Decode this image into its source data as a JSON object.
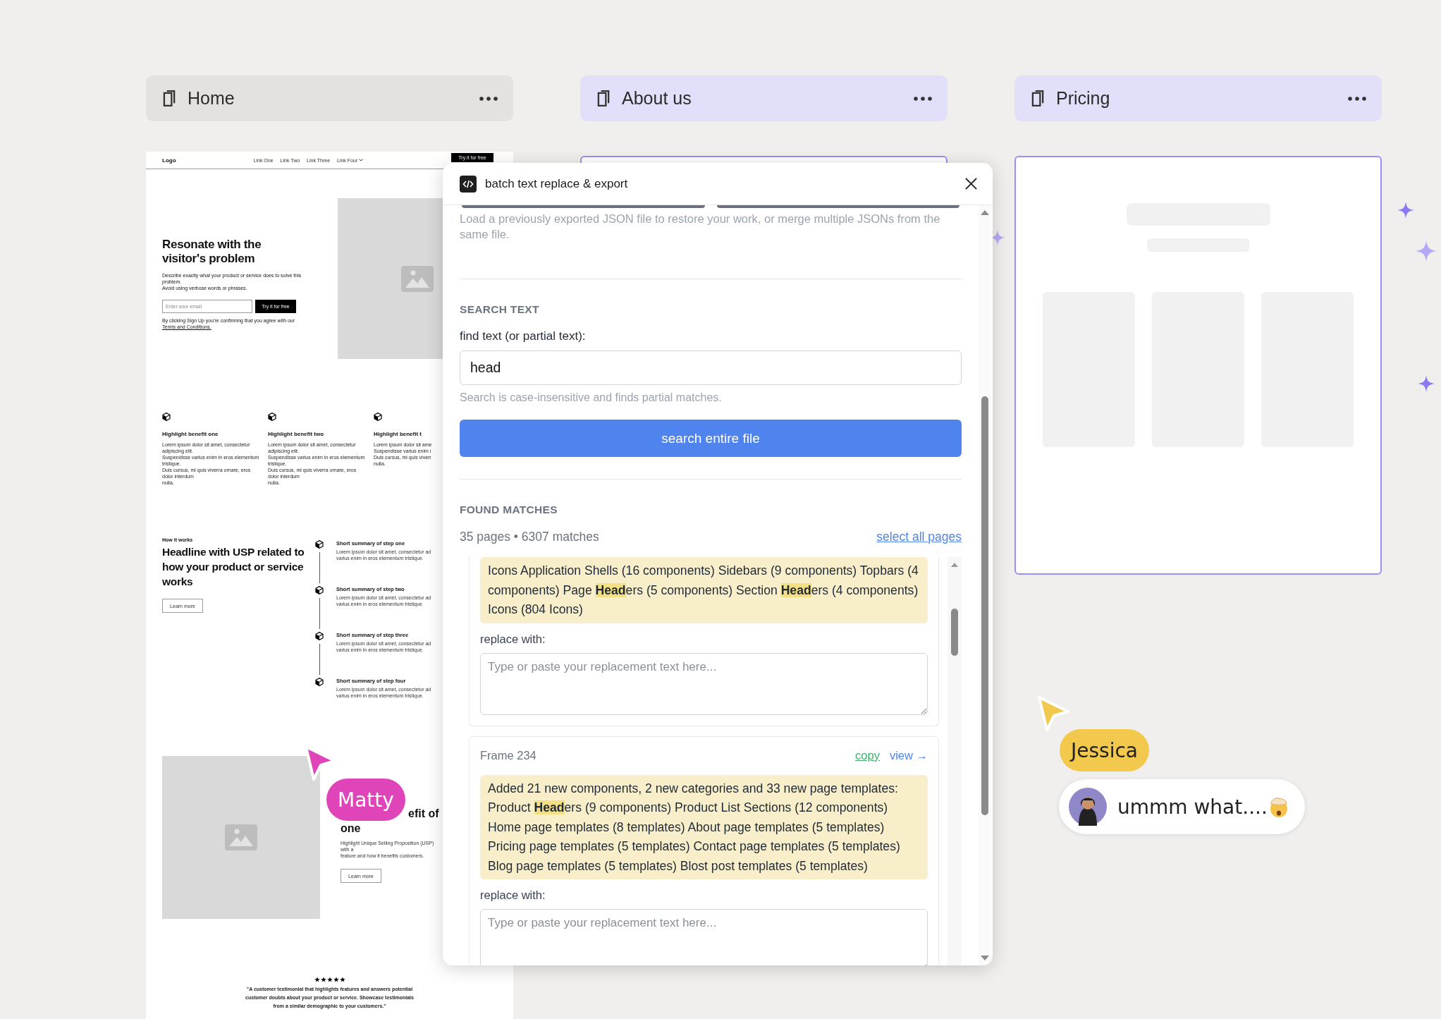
{
  "canvas": {
    "frames": [
      {
        "kind": "wireframe",
        "title": "Home",
        "selected": false,
        "content": {
          "nav": {
            "logo": "Logo",
            "links": [
              {
                "label": "Link One",
                "dropdown": false
              },
              {
                "label": "Link Two",
                "dropdown": false
              },
              {
                "label": "Link Three",
                "dropdown": false
              },
              {
                "label": "Link Four",
                "dropdown": true
              }
            ],
            "cta": "Try it for free"
          },
          "hero": {
            "heading": "Resonate with the visitor's problem",
            "description": [
              "Describe exactly what your product or service does to solve this problem.",
              "Avoid using verbose words or phrases."
            ],
            "email_placeholder": "Enter your email",
            "button": "Try it for free",
            "terms_text": "By clicking Sign Up you're confirming that you agree with our",
            "terms_link": "Terms and Conditions."
          },
          "benefits": [
            {
              "title": "Highlight benefit one",
              "body": [
                "Lorem ipsum dolor sit amet, consectetur adipiscing elit.",
                "Suspendisse varius enim in eros elementum tristique.",
                "Duis cursus, mi quis viverra ornare, eros dolor interdum",
                "nulla."
              ]
            },
            {
              "title": "Highlight benefit two",
              "body": [
                "Lorem ipsum dolor sit amet, consectetur adipiscing elit.",
                "Suspendisse varius enim in eros elementum tristique.",
                "Duis cursus, mi quis viverra ornare, eros dolor interdum",
                "nulla."
              ]
            },
            {
              "title": "Highlight benefit t",
              "body": [
                "Lorem ipsum dolor sit ame",
                "Suspendisse varius enim i",
                "Duis cursus, mi quis viverr",
                "nulla."
              ]
            }
          ],
          "how": {
            "eyebrow": "How it works",
            "heading": [
              "Headline with USP related to",
              "how your product or service",
              "works"
            ],
            "button": "Learn more",
            "steps": [
              {
                "title": "Short summary of step one",
                "body": [
                  "Lorem ipsum dolor sit amet, consectetur ad",
                  "varius enim in eros elementum tristique."
                ]
              },
              {
                "title": "Short summary of step two",
                "body": [
                  "Lorem ipsum dolor sit amet, consectetur ad",
                  "varius enim in eros elementum tristique."
                ]
              },
              {
                "title": "Short summary of step three",
                "body": [
                  "Lorem ipsum dolor sit amet, consectetur ad",
                  "varius enim in eros elementum tristique."
                ]
              },
              {
                "title": "Short summary of step four",
                "body": [
                  "Lorem ipsum dolor sit amet, consectetur ad",
                  "varius enim in eros elementum tristique."
                ]
              }
            ]
          },
          "feature": {
            "heading_fragments": [
              "efit of",
              "one"
            ],
            "description": [
              "Highlight Unique Selling Proposition (USP) with a",
              "feature and how it benefits customers."
            ],
            "button": "Learn more"
          },
          "testimonial": {
            "stars": 5,
            "quote": [
              "\"A customer testimonial that highlights features and answers potential",
              "customer doubts about your product or service. Showcase testimonials",
              "from a similar demographic to your customers.\""
            ]
          }
        }
      },
      {
        "kind": "blank",
        "title": "About us",
        "selected": true
      },
      {
        "kind": "skeleton",
        "title": "Pricing",
        "selected": true
      }
    ],
    "cursors": [
      {
        "name": "Matty",
        "color": "#e044b9"
      },
      {
        "name": "Jessica",
        "color": "#f2c94c",
        "comment": "ummm what...."
      }
    ]
  },
  "plugin": {
    "title": "batch text replace & export",
    "description": "Load a previously exported JSON file to restore your work, or merge multiple JSONs from the same file.",
    "search": {
      "heading": "SEARCH TEXT",
      "label": "find text (or partial text):",
      "value": "head",
      "hint": "Search is case-insensitive and finds partial matches.",
      "button": "search entire file"
    },
    "matches": {
      "heading": "FOUND MATCHES",
      "summary": "35 pages • 6307 matches",
      "select_all": "select all pages",
      "items": [
        {
          "text": "Icons Application Shells (16 components) Sidebars (9 components) Topbars (4 components) Page **Head**ers (5 components) Section **Head**ers (4 components) Icons (804 Icons)",
          "replace_label": "replace with:",
          "placeholder": "Type or paste your replacement text here..."
        },
        {
          "frame": "Frame 234",
          "copy": "copy",
          "view": "view →",
          "text": "Added 21 new components, 2 new categories and 33 new page templates: Product **Head**ers (9 components) Product List Sections (12 components) Home page templates (8 templates) About page templates (5 templates) Pricing page templates (5 templates) Contact page templates (5 templates) Blog page templates (5 templates) Blost post templates (5 templates)",
          "replace_label": "replace with:",
          "placeholder": "Type or paste your replacement text here..."
        }
      ]
    }
  }
}
